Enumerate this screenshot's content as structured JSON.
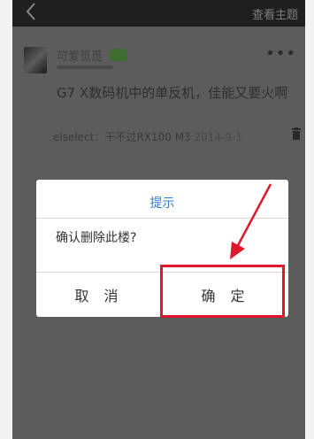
{
  "topbar": {
    "topic_link": "查看主题"
  },
  "post": {
    "username": "可爱觅觅",
    "text": "G7 X数码机中的单反机，佳能又要火啊",
    "reply_author": "elselect：",
    "reply_text": "干不过RX100 M3",
    "reply_time": "2014-9-1"
  },
  "dialog": {
    "title": "提示",
    "message": "确认删除此楼?",
    "cancel_label": "取 消",
    "confirm_label": "确 定"
  },
  "colors": {
    "dialog_title": "#2f7fd0",
    "annotation_red": "#e0162b",
    "overlay_dark": "#5c5c5c"
  }
}
